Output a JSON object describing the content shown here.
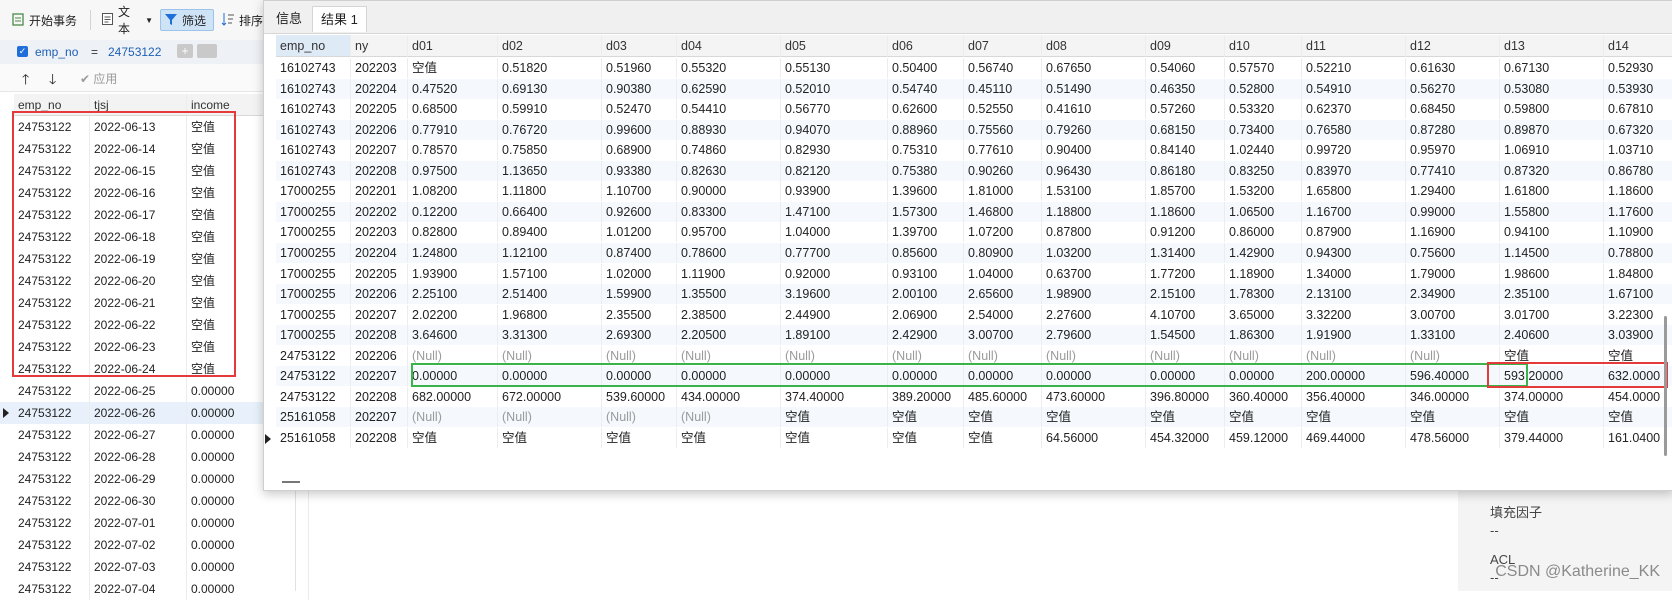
{
  "toolbar": {
    "begin_tx": "开始事务",
    "text": "文本",
    "filter": "筛选",
    "sort": "排序"
  },
  "filter": {
    "field": "emp_no",
    "op": "=",
    "value": "24753122",
    "apply": "应用"
  },
  "left_grid": {
    "columns": [
      "emp_no",
      "tjsj",
      "income"
    ],
    "rows": [
      [
        "24753122",
        "2022-06-13",
        "空值"
      ],
      [
        "24753122",
        "2022-06-14",
        "空值"
      ],
      [
        "24753122",
        "2022-06-15",
        "空值"
      ],
      [
        "24753122",
        "2022-06-16",
        "空值"
      ],
      [
        "24753122",
        "2022-06-17",
        "空值"
      ],
      [
        "24753122",
        "2022-06-18",
        "空值"
      ],
      [
        "24753122",
        "2022-06-19",
        "空值"
      ],
      [
        "24753122",
        "2022-06-20",
        "空值"
      ],
      [
        "24753122",
        "2022-06-21",
        "空值"
      ],
      [
        "24753122",
        "2022-06-22",
        "空值"
      ],
      [
        "24753122",
        "2022-06-23",
        "空值"
      ],
      [
        "24753122",
        "2022-06-24",
        "空值"
      ],
      [
        "24753122",
        "2022-06-25",
        "0.00000"
      ],
      [
        "24753122",
        "2022-06-26",
        "0.00000"
      ],
      [
        "24753122",
        "2022-06-27",
        "0.00000"
      ],
      [
        "24753122",
        "2022-06-28",
        "0.00000"
      ],
      [
        "24753122",
        "2022-06-29",
        "0.00000"
      ],
      [
        "24753122",
        "2022-06-30",
        "0.00000"
      ],
      [
        "24753122",
        "2022-07-01",
        "0.00000"
      ],
      [
        "24753122",
        "2022-07-02",
        "0.00000"
      ],
      [
        "24753122",
        "2022-07-03",
        "0.00000"
      ],
      [
        "24753122",
        "2022-07-04",
        "0.00000"
      ]
    ]
  },
  "info_panel": {
    "fill_factor_label": "填充因子",
    "fill_factor_value": "--",
    "acl_label": "ACL",
    "acl_value": "--"
  },
  "result": {
    "tabs": [
      "信息",
      "结果 1"
    ],
    "columns": [
      "emp_no",
      "ny",
      "d01",
      "d02",
      "d03",
      "d04",
      "d05",
      "d06",
      "d07",
      "d08",
      "d09",
      "d10",
      "d11",
      "d12",
      "d13",
      "d14"
    ],
    "rows": [
      [
        "16102743",
        "202203",
        "空值",
        "0.51820",
        "0.51960",
        "0.55320",
        "0.55130",
        "0.50400",
        "0.56740",
        "0.67650",
        "0.54060",
        "0.57570",
        "0.52210",
        "0.61630",
        "0.67130",
        "0.52930"
      ],
      [
        "16102743",
        "202204",
        "0.47520",
        "0.69130",
        "0.90380",
        "0.62590",
        "0.52010",
        "0.54740",
        "0.45110",
        "0.51490",
        "0.46350",
        "0.52800",
        "0.54910",
        "0.56270",
        "0.53080",
        "0.53930"
      ],
      [
        "16102743",
        "202205",
        "0.68500",
        "0.59910",
        "0.52470",
        "0.54410",
        "0.56770",
        "0.62600",
        "0.52550",
        "0.41610",
        "0.57260",
        "0.53320",
        "0.62370",
        "0.68450",
        "0.59800",
        "0.67810"
      ],
      [
        "16102743",
        "202206",
        "0.77910",
        "0.76720",
        "0.99600",
        "0.88930",
        "0.94070",
        "0.88960",
        "0.75560",
        "0.79260",
        "0.68150",
        "0.73400",
        "0.76580",
        "0.87280",
        "0.89870",
        "0.67320"
      ],
      [
        "16102743",
        "202207",
        "0.78570",
        "0.75850",
        "0.68900",
        "0.74860",
        "0.82930",
        "0.75310",
        "0.77610",
        "0.90400",
        "0.84140",
        "1.02440",
        "0.99720",
        "0.95970",
        "1.06910",
        "1.03710"
      ],
      [
        "16102743",
        "202208",
        "0.97500",
        "1.13650",
        "0.93380",
        "0.82630",
        "0.82120",
        "0.75380",
        "0.90260",
        "0.96430",
        "0.86180",
        "0.83250",
        "0.83970",
        "0.77410",
        "0.87320",
        "0.86780"
      ],
      [
        "17000255",
        "202201",
        "1.08200",
        "1.11800",
        "1.10700",
        "0.90000",
        "0.93900",
        "1.39600",
        "1.81000",
        "1.53100",
        "1.85700",
        "1.53200",
        "1.65800",
        "1.29400",
        "1.61800",
        "1.18600"
      ],
      [
        "17000255",
        "202202",
        "0.12200",
        "0.66400",
        "0.92600",
        "0.83300",
        "1.47100",
        "1.57300",
        "1.46800",
        "1.18800",
        "1.18600",
        "1.06500",
        "1.16700",
        "0.99000",
        "1.55800",
        "1.17600"
      ],
      [
        "17000255",
        "202203",
        "0.82800",
        "0.89400",
        "1.01200",
        "0.95700",
        "1.04000",
        "1.39700",
        "1.07200",
        "0.87800",
        "0.91200",
        "0.86000",
        "0.87900",
        "1.16900",
        "0.94100",
        "1.10900"
      ],
      [
        "17000255",
        "202204",
        "1.24800",
        "1.12100",
        "0.87400",
        "0.78600",
        "0.77700",
        "0.85600",
        "0.80900",
        "1.03200",
        "1.31400",
        "1.42900",
        "0.94300",
        "0.75600",
        "1.14500",
        "0.78800"
      ],
      [
        "17000255",
        "202205",
        "1.93900",
        "1.57100",
        "1.02000",
        "1.11900",
        "0.92000",
        "0.93100",
        "1.04000",
        "0.63700",
        "1.77200",
        "1.18900",
        "1.34000",
        "1.79000",
        "1.98600",
        "1.84800"
      ],
      [
        "17000255",
        "202206",
        "2.25100",
        "2.51400",
        "1.59900",
        "1.35500",
        "3.19600",
        "2.00100",
        "2.65600",
        "1.98900",
        "2.15100",
        "1.78300",
        "2.13100",
        "2.34900",
        "2.35100",
        "1.67100"
      ],
      [
        "17000255",
        "202207",
        "2.02200",
        "1.96800",
        "2.35500",
        "2.38500",
        "2.44900",
        "2.06900",
        "2.54000",
        "2.27600",
        "4.10700",
        "3.65000",
        "3.32200",
        "3.00700",
        "3.01700",
        "3.22300"
      ],
      [
        "17000255",
        "202208",
        "3.64600",
        "3.31300",
        "2.69300",
        "2.20500",
        "1.89100",
        "2.42900",
        "3.00700",
        "2.79600",
        "1.54500",
        "1.86300",
        "1.91900",
        "1.33100",
        "2.40600",
        "3.03900"
      ],
      [
        "24753122",
        "202206",
        "(Null)",
        "(Null)",
        "(Null)",
        "(Null)",
        "(Null)",
        "(Null)",
        "(Null)",
        "(Null)",
        "(Null)",
        "(Null)",
        "(Null)",
        "(Null)",
        "空值",
        "空值"
      ],
      [
        "24753122",
        "202207",
        "0.00000",
        "0.00000",
        "0.00000",
        "0.00000",
        "0.00000",
        "0.00000",
        "0.00000",
        "0.00000",
        "0.00000",
        "0.00000",
        "200.00000",
        "596.40000",
        "593.20000",
        "632.0000"
      ],
      [
        "24753122",
        "202208",
        "682.00000",
        "672.00000",
        "539.60000",
        "434.00000",
        "374.40000",
        "389.20000",
        "485.60000",
        "473.60000",
        "396.80000",
        "360.40000",
        "356.40000",
        "346.00000",
        "374.00000",
        "454.0000"
      ],
      [
        "25161058",
        "202207",
        "(Null)",
        "(Null)",
        "(Null)",
        "(Null)",
        "空值",
        "空值",
        "空值",
        "空值",
        "空值",
        "空值",
        "空值",
        "空值",
        "空值",
        "空值"
      ],
      [
        "25161058",
        "202208",
        "空值",
        "空值",
        "空值",
        "空值",
        "空值",
        "空值",
        "空值",
        "64.56000",
        "454.32000",
        "459.12000",
        "469.44000",
        "478.56000",
        "379.44000",
        "161.0400"
      ]
    ]
  },
  "watermark": "CSDN @Katherine_KK"
}
